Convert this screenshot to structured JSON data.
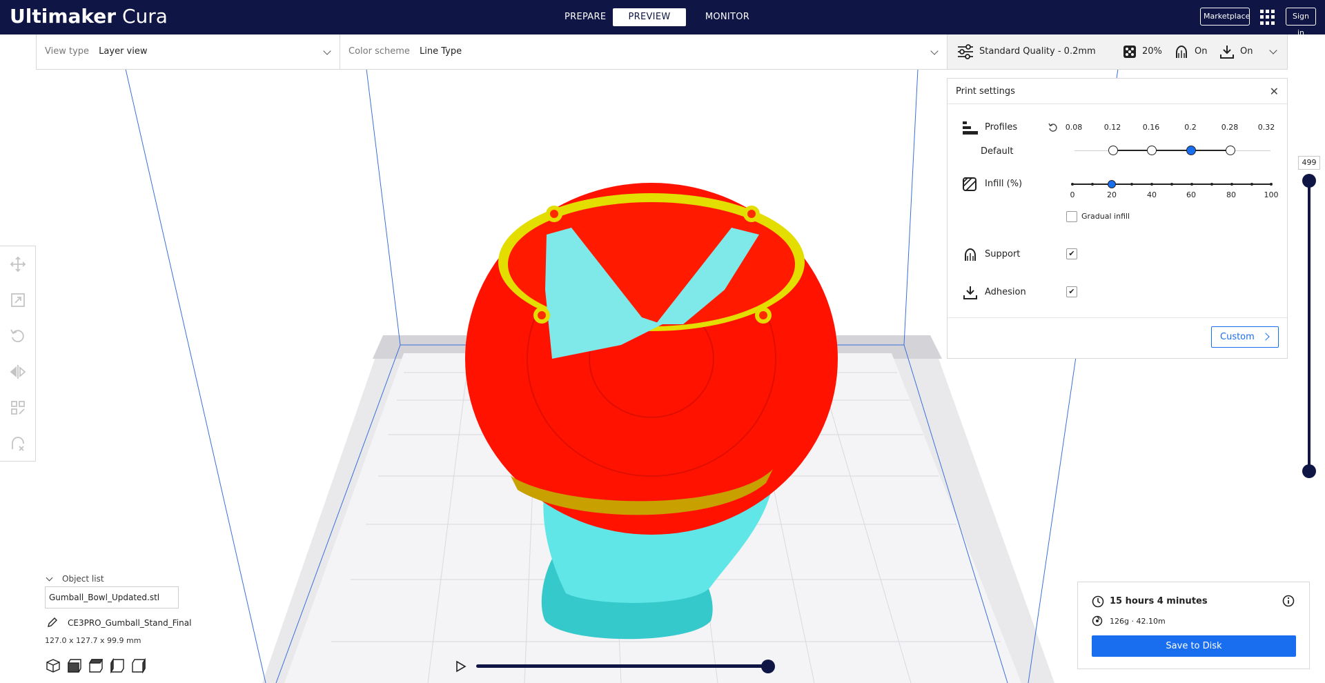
{
  "app": {
    "logo_bold": "Ultimaker",
    "logo_light": "Cura"
  },
  "header": {
    "tabs": [
      {
        "label": "PREPARE",
        "active": false
      },
      {
        "label": "PREVIEW",
        "active": true
      },
      {
        "label": "MONITOR",
        "active": false
      }
    ],
    "marketplace_label": "Marketplace",
    "signin_label": "Sign in",
    "apps_icon": "apps-grid-icon"
  },
  "toolbar": {
    "view_type_label": "View type",
    "view_type_value": "Layer view",
    "color_scheme_label": "Color scheme",
    "color_scheme_value": "Line Type"
  },
  "quality_bar": {
    "profile": "Standard Quality - 0.2mm",
    "infill": "20%",
    "support": "On",
    "adhesion": "On"
  },
  "print_settings": {
    "title": "Print settings",
    "close_icon": "close-icon",
    "profiles": {
      "label": "Profiles",
      "sublabel": "Default",
      "ticks": [
        "0.08",
        "0.12",
        "0.16",
        "0.2",
        "0.28",
        "0.32"
      ],
      "selected": "0.2"
    },
    "infill": {
      "label": "Infill (%)",
      "ticks": [
        "0",
        "20",
        "40",
        "60",
        "80",
        "100"
      ],
      "value": 20
    },
    "gradual_infill": {
      "label": "Gradual infill",
      "checked": false
    },
    "support": {
      "label": "Support",
      "checked": true
    },
    "adhesion": {
      "label": "Adhesion",
      "checked": true
    },
    "custom_label": "Custom",
    "check_glyph": "✔"
  },
  "object_list": {
    "title": "Object list",
    "file": "Gumball_Bowl_Updated.stl",
    "name": "CE3PRO_Gumball_Stand_Final",
    "dims": "127.0 x 127.7 x 99.9 mm"
  },
  "layer_slider": {
    "value": "499"
  },
  "estimate": {
    "time": "15 hours 4 minutes",
    "material": "126g · 42.10m",
    "save_label": "Save to Disk"
  },
  "colors": {
    "header_bg": "#0f1544",
    "accent": "#196ef0",
    "shell": "#ff1a00",
    "support": "#4fe8e8",
    "skin": "#e8e000"
  }
}
